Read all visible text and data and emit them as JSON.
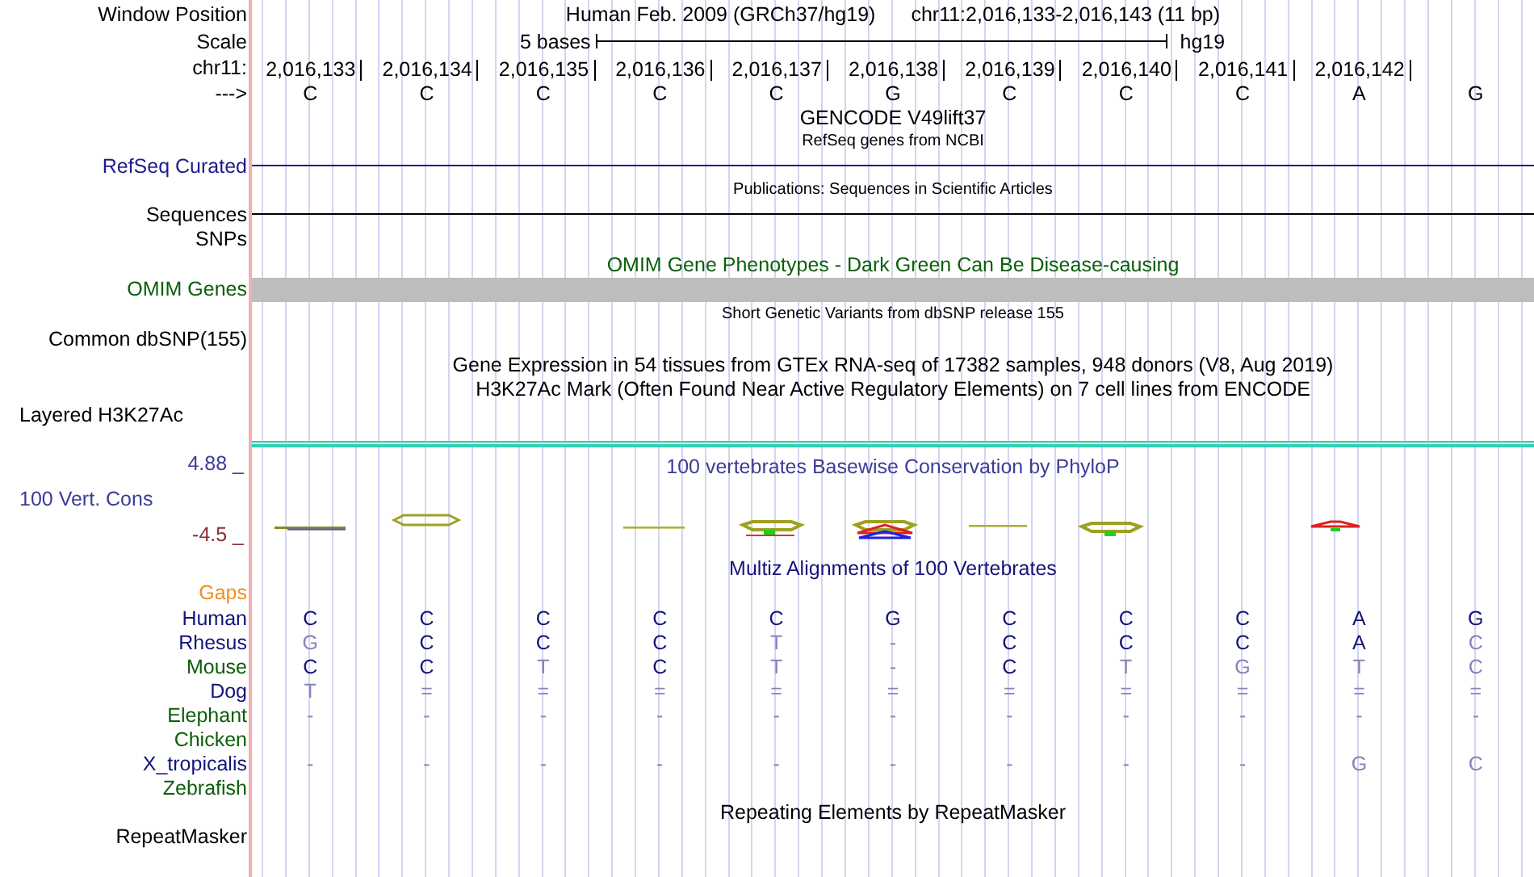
{
  "header": {
    "label": "Window Position",
    "assembly": "Human Feb. 2009 (GRCh37/hg19)",
    "position": "chr11:2,016,133-2,016,143 (11 bp)"
  },
  "scale": {
    "label": "Scale",
    "span": "5 bases",
    "assembly": "hg19"
  },
  "ruler": {
    "label": "chr11:",
    "positions": [
      "2,016,133",
      "2,016,134",
      "2,016,135",
      "2,016,136",
      "2,016,137",
      "2,016,138",
      "2,016,139",
      "2,016,140",
      "2,016,141",
      "2,016,142"
    ]
  },
  "strand": {
    "label": "--->",
    "bases": [
      "C",
      "C",
      "C",
      "C",
      "C",
      "G",
      "C",
      "C",
      "C",
      "A",
      "G"
    ]
  },
  "rows": [
    {
      "kind": "title",
      "title": "GENCODE V49lift37",
      "color": "#000000"
    },
    {
      "kind": "subtitle",
      "title": "RefSeq genes from NCBI",
      "color": "#000000"
    },
    {
      "kind": "line",
      "label": "RefSeq Curated",
      "color": "#1c1c8c"
    },
    {
      "kind": "subtitle",
      "title": "Publications: Sequences in Scientific Articles",
      "color": "#000000"
    },
    {
      "kind": "line",
      "label": "Sequences",
      "color": "#000000"
    },
    {
      "kind": "label",
      "label": "SNPs",
      "color": "#000000"
    },
    {
      "kind": "title",
      "title": "OMIM Gene Phenotypes - Dark Green Can Be Disease-causing",
      "color": "#0b5e0b"
    },
    {
      "kind": "bar",
      "label": "OMIM Genes",
      "color": "#0b5e0b"
    },
    {
      "kind": "subtitle",
      "title": "Short Genetic Variants from dbSNP release 155",
      "color": "#000000"
    },
    {
      "kind": "label",
      "label": "Common dbSNP(155)",
      "color": "#000000"
    },
    {
      "kind": "title",
      "title": "Gene Expression in 54 tissues from GTEx RNA-seq of 17382 samples, 948 donors (V8, Aug 2019)",
      "color": "#000000"
    },
    {
      "kind": "title",
      "title": "H3K27Ac Mark (Often Found Near Active Regulatory Elements) on 7 cell lines from ENCODE",
      "color": "#000000"
    },
    {
      "kind": "layered",
      "label": "Layered H3K27Ac",
      "color": "#000000"
    },
    {
      "kind": "conservation",
      "title": "100 vertebrates Basewise Conservation by PhyloP",
      "max": "4.88 _",
      "label": "100 Vert. Cons",
      "min": "-4.5 _",
      "color": "#3c3c96"
    },
    {
      "kind": "title",
      "title": "Multiz Alignments of 100 Vertebrates",
      "color": "#14147a"
    },
    {
      "kind": "label",
      "label": "Gaps",
      "color": "#ee9020"
    },
    {
      "kind": "species",
      "label": "Human",
      "color": "#14147a",
      "cells": [
        {
          "text": "C",
          "faded": false
        },
        {
          "text": "C",
          "faded": false
        },
        {
          "text": "C",
          "faded": false
        },
        {
          "text": "C",
          "faded": false
        },
        {
          "text": "C",
          "faded": false
        },
        {
          "text": "G",
          "faded": false
        },
        {
          "text": "C",
          "faded": false
        },
        {
          "text": "C",
          "faded": false
        },
        {
          "text": "C",
          "faded": false
        },
        {
          "text": "A",
          "faded": false
        },
        {
          "text": "G",
          "faded": false
        }
      ]
    },
    {
      "kind": "species",
      "label": "Rhesus",
      "color": "#14147a",
      "cells": [
        {
          "text": "G",
          "faded": true
        },
        {
          "text": "C",
          "faded": false
        },
        {
          "text": "C",
          "faded": false
        },
        {
          "text": "C",
          "faded": false
        },
        {
          "text": "T",
          "faded": true
        },
        {
          "text": "-",
          "faded": true
        },
        {
          "text": "C",
          "faded": false
        },
        {
          "text": "C",
          "faded": false
        },
        {
          "text": "C",
          "faded": false
        },
        {
          "text": "A",
          "faded": false
        },
        {
          "text": "C",
          "faded": true
        }
      ]
    },
    {
      "kind": "species",
      "label": "Mouse",
      "color": "#0b5e0b",
      "cells": [
        {
          "text": "C",
          "faded": false
        },
        {
          "text": "C",
          "faded": false
        },
        {
          "text": "T",
          "faded": true
        },
        {
          "text": "C",
          "faded": false
        },
        {
          "text": "T",
          "faded": true
        },
        {
          "text": "-",
          "faded": true
        },
        {
          "text": "C",
          "faded": false
        },
        {
          "text": "T",
          "faded": true
        },
        {
          "text": "G",
          "faded": true
        },
        {
          "text": "T",
          "faded": true
        },
        {
          "text": "C",
          "faded": true
        }
      ]
    },
    {
      "kind": "species",
      "label": "Dog",
      "color": "#14147a",
      "cells": [
        {
          "text": "T",
          "faded": true
        },
        {
          "text": "=",
          "faded": true
        },
        {
          "text": "=",
          "faded": true
        },
        {
          "text": "=",
          "faded": true
        },
        {
          "text": "=",
          "faded": true
        },
        {
          "text": "=",
          "faded": true
        },
        {
          "text": "=",
          "faded": true
        },
        {
          "text": "=",
          "faded": true
        },
        {
          "text": "=",
          "faded": true
        },
        {
          "text": "=",
          "faded": true
        },
        {
          "text": "=",
          "faded": true
        }
      ]
    },
    {
      "kind": "species",
      "label": "Elephant",
      "color": "#0b5e0b",
      "cells": [
        {
          "text": "-",
          "faded": true
        },
        {
          "text": "-",
          "faded": true
        },
        {
          "text": "-",
          "faded": true
        },
        {
          "text": "-",
          "faded": true
        },
        {
          "text": "-",
          "faded": true
        },
        {
          "text": "-",
          "faded": true
        },
        {
          "text": "-",
          "faded": true
        },
        {
          "text": "-",
          "faded": true
        },
        {
          "text": "-",
          "faded": true
        },
        {
          "text": "-",
          "faded": true
        },
        {
          "text": "-",
          "faded": true
        }
      ]
    },
    {
      "kind": "species",
      "label": "Chicken",
      "color": "#0b5e0b"
    },
    {
      "kind": "species",
      "label": "X_tropicalis",
      "color": "#14147a",
      "cells": [
        {
          "text": "-",
          "faded": true
        },
        {
          "text": "-",
          "faded": true
        },
        {
          "text": "-",
          "faded": true
        },
        {
          "text": "-",
          "faded": true
        },
        {
          "text": "-",
          "faded": true
        },
        {
          "text": "-",
          "faded": true
        },
        {
          "text": "-",
          "faded": true
        },
        {
          "text": "-",
          "faded": true
        },
        {
          "text": "-",
          "faded": true
        },
        {
          "text": "G",
          "faded": true
        },
        {
          "text": "C",
          "faded": true
        }
      ]
    },
    {
      "kind": "species",
      "label": "Zebrafish",
      "color": "#0b5e0b"
    },
    {
      "kind": "title",
      "title": "Repeating Elements by RepeatMasker",
      "color": "#000000"
    },
    {
      "kind": "label",
      "label": "RepeatMasker",
      "color": "#000000"
    }
  ]
}
